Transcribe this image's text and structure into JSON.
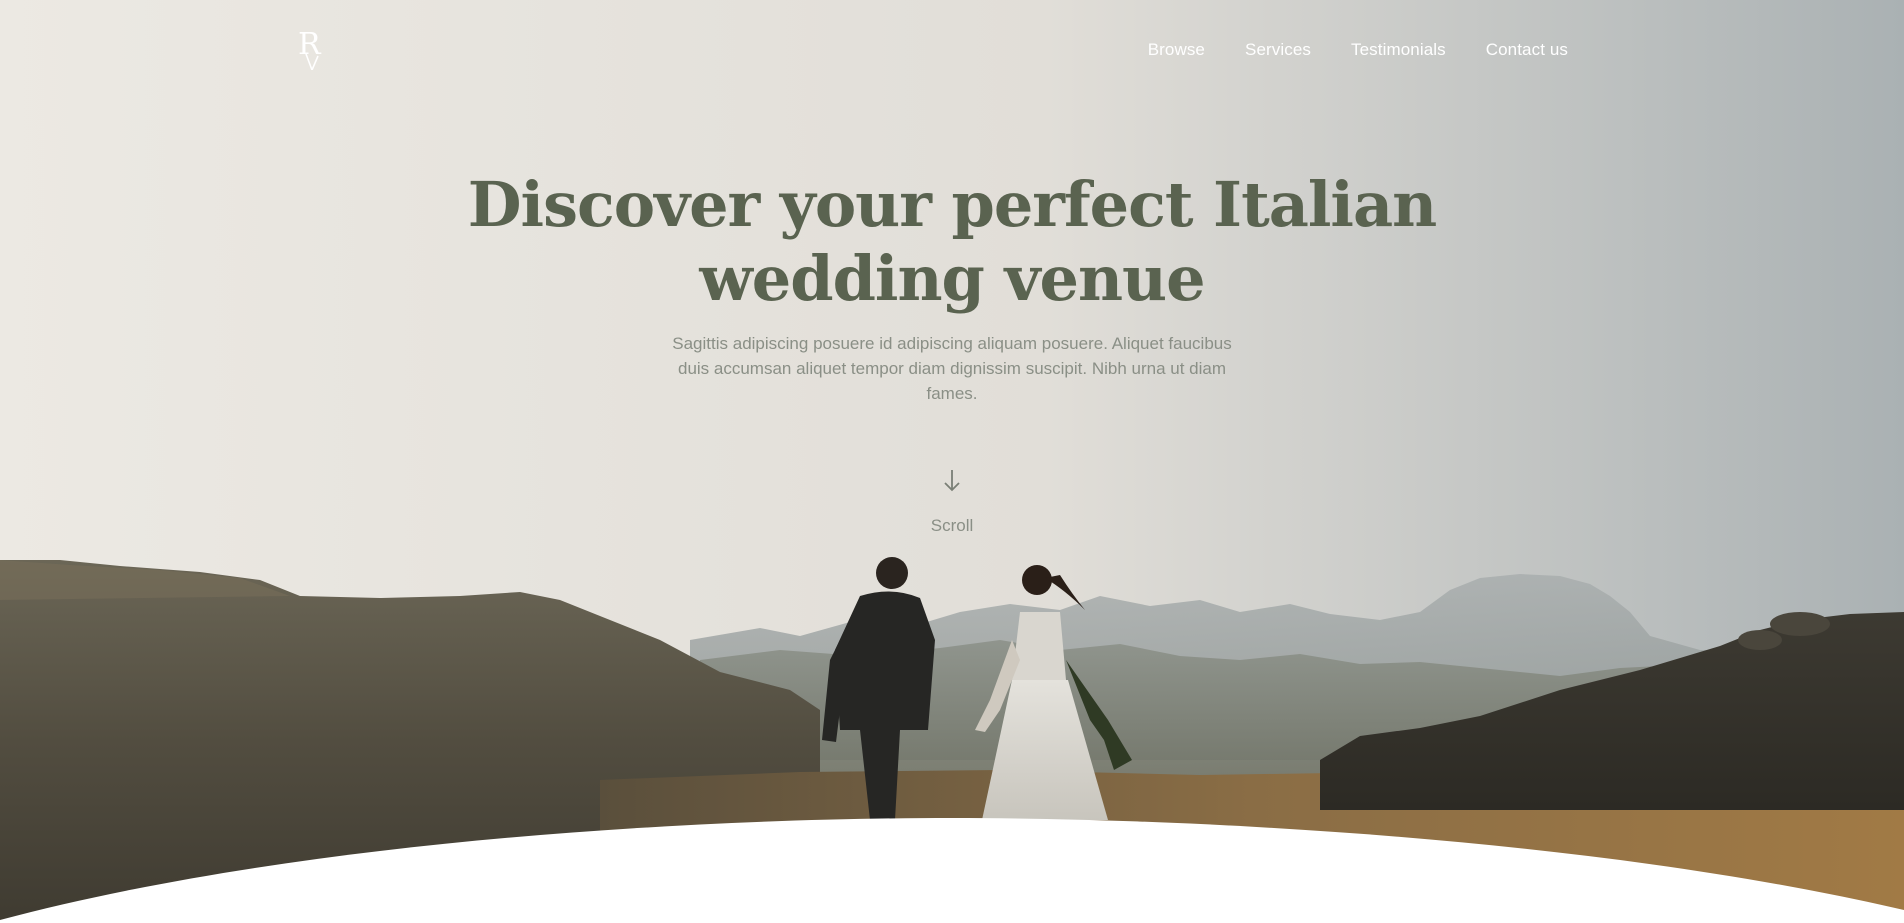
{
  "brand": {
    "logo_text": "R"
  },
  "nav": {
    "items": [
      {
        "label": "Browse"
      },
      {
        "label": "Services"
      },
      {
        "label": "Testimonials"
      },
      {
        "label": "Contact us"
      }
    ]
  },
  "hero": {
    "headline": "Discover your perfect Italian wedding venue",
    "subtext": "Sagittis adipiscing posuere id adipiscing aliquam posuere. Aliquet faucibus duis accumsan aliquet tempor diam dignissim suscipit. Nibh urna ut diam fames.",
    "scroll_label": "Scroll",
    "scroll_icon": "arrow-down-icon"
  },
  "colors": {
    "headline": "#5a6350",
    "body_text": "#8a8f86",
    "nav_text": "#ffffff",
    "page_bg": "#ffffff"
  }
}
